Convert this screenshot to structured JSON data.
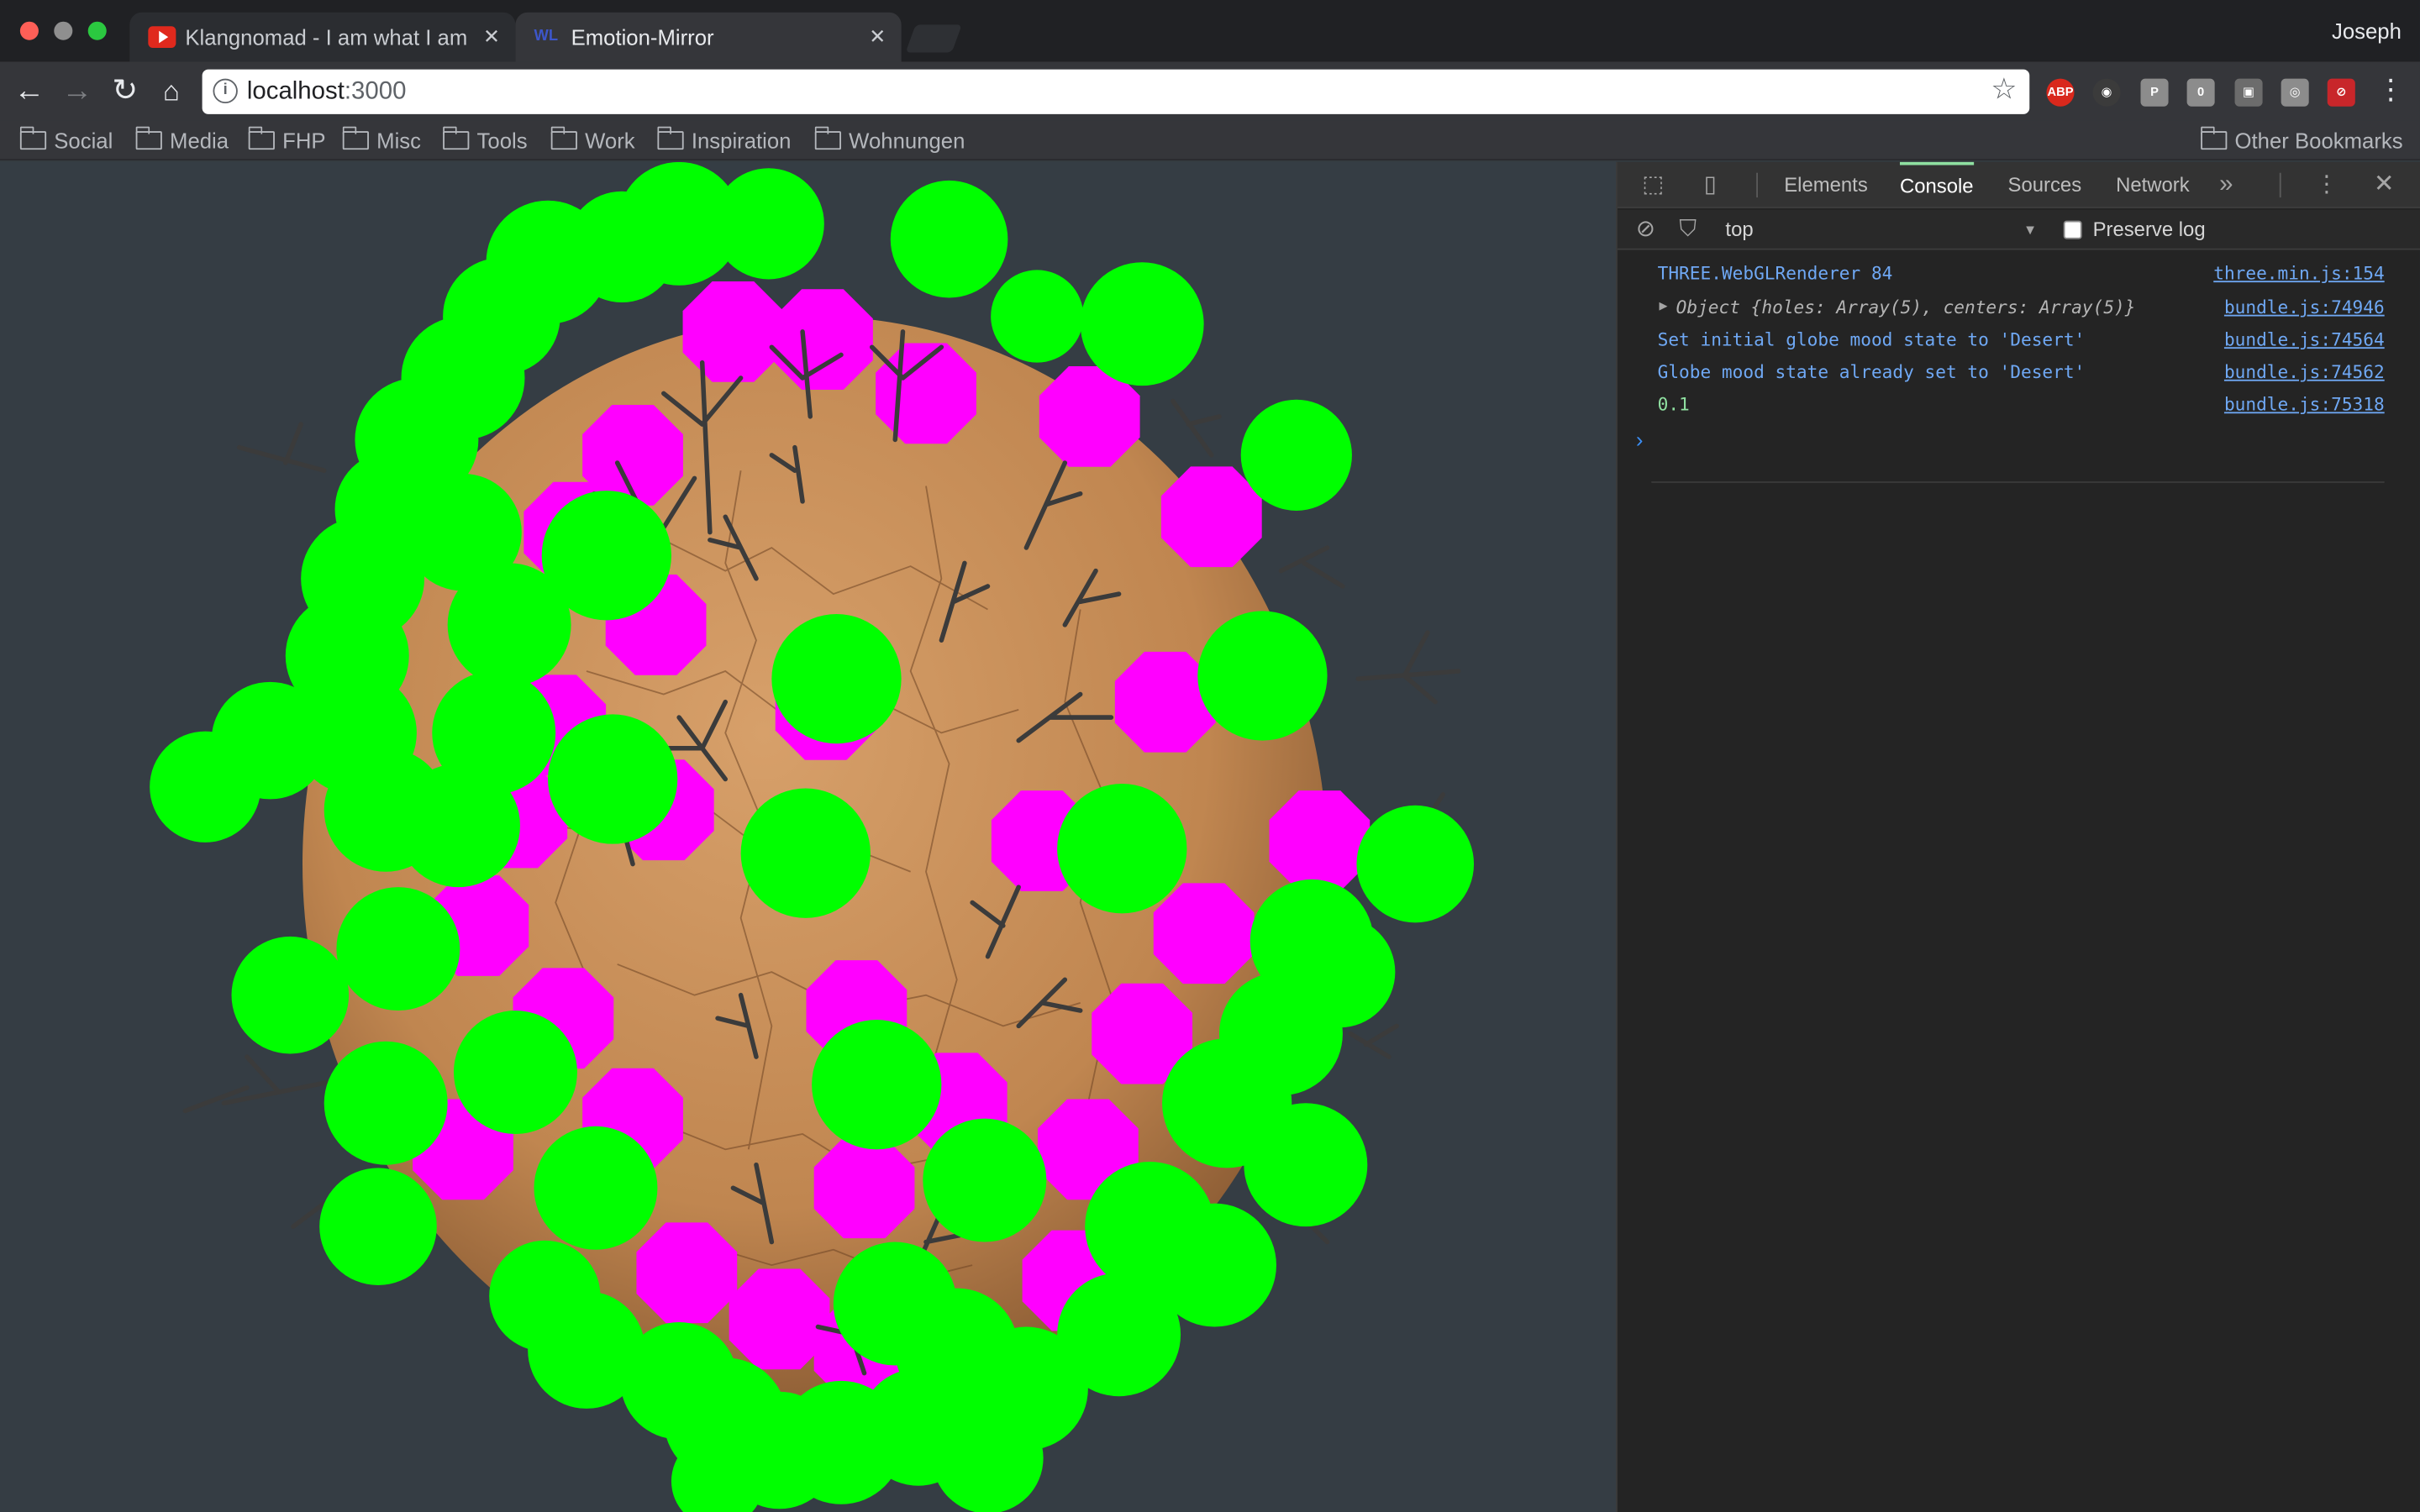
{
  "browser": {
    "tabs": [
      {
        "label": "Klangnomad - I am what I am -",
        "favicon": "youtube-icon",
        "active": false
      },
      {
        "label": "Emotion-Mirror",
        "favicon": "wl-icon",
        "favicon_text": "WL",
        "active": true
      }
    ],
    "tab_close": "✕",
    "profile": "Joseph",
    "url_host": "localhost",
    "url_port": ":3000",
    "extensions": [
      {
        "name": "abp-icon",
        "text": "ABP",
        "color": "#d9281c"
      },
      {
        "name": "color-picker-icon",
        "text": "◉",
        "color": "#3b3b3b"
      },
      {
        "name": "p-icon",
        "text": "P",
        "color": "#8c8c8c"
      },
      {
        "name": "zero-icon",
        "text": "0",
        "color": "#8c8c8c"
      },
      {
        "name": "photo-icon",
        "text": "▣",
        "color": "#6c6c6c"
      },
      {
        "name": "react-icon",
        "text": "◎",
        "color": "#8c8c8c"
      },
      {
        "name": "block-icon",
        "text": "⊘",
        "color": "#c8262a"
      }
    ]
  },
  "bookmarks": {
    "items": [
      "Social",
      "Media",
      "FHP",
      "Misc",
      "Tools",
      "Work",
      "Inspiration",
      "Wohnungen"
    ],
    "other": "Other Bookmarks"
  },
  "devtools": {
    "tabs": [
      "Elements",
      "Console",
      "Sources",
      "Network"
    ],
    "active_tab": "Console",
    "more": "»",
    "context": "top",
    "preserve_log": "Preserve log",
    "console": [
      {
        "message": "THREE.WebGLRenderer 84",
        "source": "three.min.js:154",
        "kind": "info"
      },
      {
        "message": "Object {holes: Array(5), centers: Array(5)}",
        "source": "bundle.js:74946",
        "kind": "object"
      },
      {
        "message": "Set initial globe mood state to 'Desert'",
        "source": "bundle.js:74564",
        "kind": "info"
      },
      {
        "message": "Globe mood state already set to 'Desert'",
        "source": "bundle.js:74562",
        "kind": "info"
      },
      {
        "message": "0.1",
        "source": "bundle.js:75318",
        "kind": "number"
      }
    ],
    "prompt": "›"
  },
  "scene": {
    "globe_color": "#c98f58",
    "hole_color": "#ff00ff",
    "tree_color": "#00ff00",
    "background": "#353d44"
  }
}
